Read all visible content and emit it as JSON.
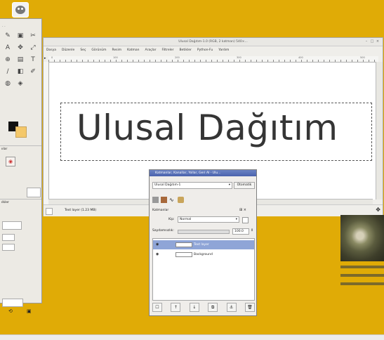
{
  "desktop": {
    "bg_color": "#e0ab06",
    "icon": "gimp-wilber-icon"
  },
  "toolbox": {
    "tools": [
      "✎",
      "▣",
      "✂",
      "A",
      "✥",
      "⤢",
      "⊕",
      "▤",
      "T",
      "∕",
      "◧",
      "✐",
      "◍",
      "◈"
    ],
    "icons": [
      "pencil-icon",
      "rect-select-icon",
      "scissors-icon",
      "text-tool-icon",
      "move-icon",
      "scale-icon",
      "zoom-icon",
      "save-icon",
      "type-icon",
      "path-icon",
      "eraser-icon",
      "brush-icon",
      "bucket-icon",
      "clone-icon"
    ],
    "labels": [
      "ıılar",
      "ılkler"
    ]
  },
  "image_window": {
    "title": "Ulusal Dağıtım-1.0 (RGB, 2 katman) 540×...",
    "menu": [
      "Dosya",
      "Düzenle",
      "Seç",
      "Görünüm",
      "Resim",
      "Katman",
      "Araçlar",
      "Filtreler",
      "Betikler",
      "Python-Fu",
      "Yardım"
    ],
    "canvas_text": "Ulusal Dağıtım",
    "status": "Text layer (1.23 MB)",
    "ruler_marks": [
      "0",
      "100",
      "200",
      "300",
      "400",
      "500"
    ]
  },
  "layers_dialog": {
    "title": "Katmanlar, Kanallar, Yollar, Geri Al - Ulu...",
    "image_select": "Ulusal Dağıtım-1",
    "auto_button": "Otomatik",
    "section_label": "Katmanlar",
    "mode_label": "Kip:",
    "mode_value": "Normal",
    "opacity_label": "Saydamsızlık:",
    "opacity_value": "100.0",
    "layers": [
      {
        "name": "Text layer",
        "selected": true
      },
      {
        "name": "Background",
        "selected": false
      }
    ],
    "footer_buttons": [
      "☐",
      "↑",
      "↓",
      "⧉",
      "⚓",
      "🗑"
    ]
  },
  "colors": {
    "selection": "#8fa5d7",
    "title_active": "#4a63ad"
  }
}
